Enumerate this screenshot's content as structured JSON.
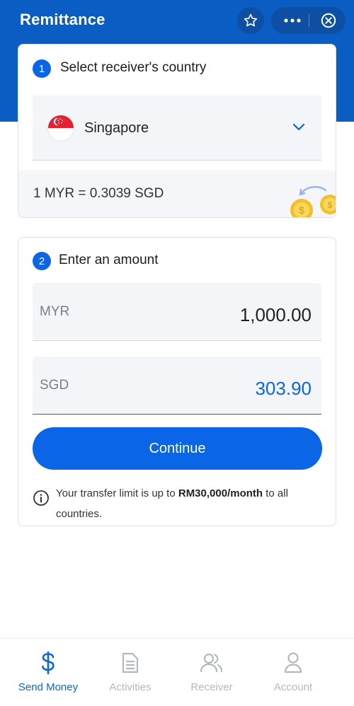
{
  "header": {
    "title": "Remittance",
    "colors": {
      "background": "#0a5dc2",
      "button": "#0c4fa3"
    }
  },
  "step1": {
    "number": "1",
    "title": "Select receiver's country",
    "country": {
      "name": "Singapore",
      "flag": "singapore-flag"
    },
    "rate_text": "1 MYR = 0.3039 SGD"
  },
  "step2": {
    "number": "2",
    "title": "Enter an amount",
    "from": {
      "currency": "MYR",
      "amount": "1,000.00"
    },
    "to": {
      "currency": "SGD",
      "amount": "303.90"
    },
    "continue_label": "Continue",
    "info": {
      "prefix": "Your transfer limit is up to ",
      "limit": "RM30,000/month",
      "suffix": " to all countries."
    }
  },
  "tabs": [
    {
      "label": "Send Money",
      "icon": "dollar-icon",
      "active": true
    },
    {
      "label": "Activities",
      "icon": "document-icon",
      "active": false
    },
    {
      "label": "Receiver",
      "icon": "users-icon",
      "active": false
    },
    {
      "label": "Account",
      "icon": "person-icon",
      "active": false
    }
  ],
  "accent": "#0a66e6"
}
